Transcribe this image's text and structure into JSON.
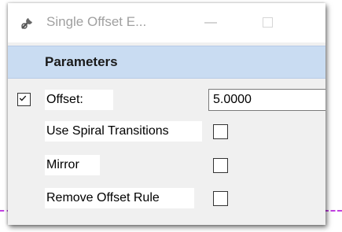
{
  "window": {
    "title": "Single Offset E...",
    "app_icon": "offset-tool-icon",
    "minimize_glyph": "—"
  },
  "parameters": {
    "header": "Parameters",
    "offset": {
      "label": "Offset:",
      "value": "5.0000",
      "enabled": true
    },
    "use_spiral_transitions": {
      "label": "Use Spiral Transitions",
      "checked": false
    },
    "mirror": {
      "label": "Mirror",
      "checked": false
    },
    "remove_offset_rule": {
      "label": "Remove Offset Rule",
      "checked": false
    }
  },
  "colors": {
    "header_bg": "#c9dcf2",
    "dialog_bg": "#f0f0f0",
    "guide_line": "#c040e0"
  }
}
